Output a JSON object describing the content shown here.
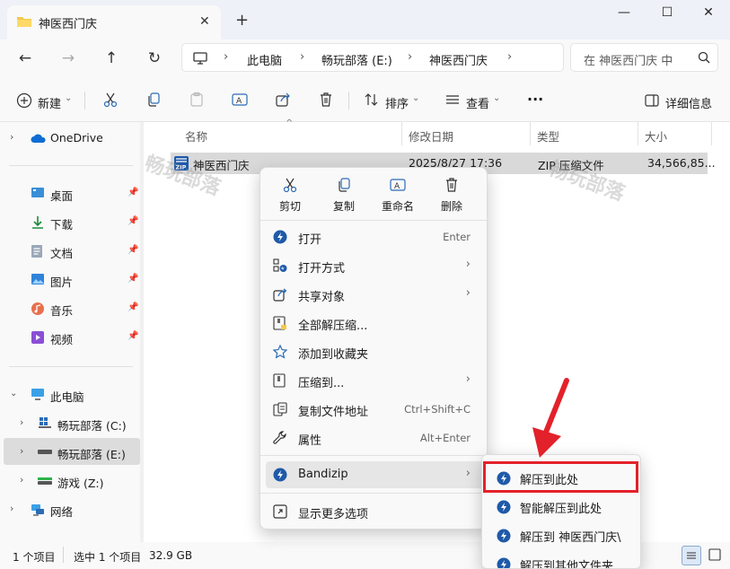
{
  "window": {
    "tab_title": "神医西门庆",
    "tab_close": "✕",
    "new_tab": "+",
    "minimize": "—",
    "maximize": "☐",
    "close": "✕"
  },
  "nav": {
    "back": "←",
    "forward": "→",
    "up": "↑",
    "refresh": "↻",
    "breadcrumb": [
      "此电脑",
      "畅玩部落 (E:)",
      "神医西门庆"
    ],
    "search_placeholder": "在 神医西门庆 中"
  },
  "toolbar": {
    "new_label": "新建",
    "sort_label": "排序",
    "view_label": "查看",
    "more_label": "···",
    "details_label": "详细信息"
  },
  "sidebar": {
    "onedrive": "OneDrive",
    "quick": [
      {
        "label": "桌面",
        "icon": "desktop-icon"
      },
      {
        "label": "下载",
        "icon": "download-icon"
      },
      {
        "label": "文档",
        "icon": "document-icon"
      },
      {
        "label": "图片",
        "icon": "pictures-icon"
      },
      {
        "label": "音乐",
        "icon": "music-icon"
      },
      {
        "label": "视频",
        "icon": "video-icon"
      }
    ],
    "this_pc": "此电脑",
    "drives": [
      {
        "label": "畅玩部落 (C:)"
      },
      {
        "label": "畅玩部落 (E:)"
      },
      {
        "label": "游戏 (Z:)"
      }
    ],
    "network": "网络"
  },
  "columns": {
    "name": "名称",
    "date": "修改日期",
    "type": "类型",
    "size": "大小"
  },
  "file": {
    "name": "神医西门庆",
    "date": "2025/8/27 17:36",
    "type": "ZIP 压缩文件",
    "size": "34,566,85..."
  },
  "watermark": "畅玩部落",
  "statusbar": {
    "count": "1 个项目",
    "selected": "选中 1 个项目",
    "size": "32.9 GB"
  },
  "context_menu": {
    "quick_actions": [
      {
        "label": "剪切",
        "icon": "cut-icon"
      },
      {
        "label": "复制",
        "icon": "copy-icon"
      },
      {
        "label": "重命名",
        "icon": "rename-icon"
      },
      {
        "label": "删除",
        "icon": "delete-icon"
      }
    ],
    "items": [
      {
        "label": "打开",
        "shortcut": "Enter"
      },
      {
        "label": "打开方式"
      },
      {
        "label": "共享对象"
      },
      {
        "label": "全部解压缩..."
      },
      {
        "label": "添加到收藏夹"
      },
      {
        "label": "压缩到..."
      },
      {
        "label": "复制文件地址",
        "shortcut": "Ctrl+Shift+C"
      },
      {
        "label": "属性",
        "shortcut": "Alt+Enter"
      },
      {
        "label": "Bandizip"
      },
      {
        "label": "显示更多选项"
      }
    ],
    "submenu_arrow": "›"
  },
  "submenu": {
    "items": [
      {
        "label": "解压到此处"
      },
      {
        "label": "智能解压到此处"
      },
      {
        "label": "解压到 神医西门庆\\"
      },
      {
        "label": "解压到其他文件夹..."
      }
    ]
  },
  "colors": {
    "accent": "#0067c0",
    "highlight_box": "#e3212a",
    "selection": "#d9d9d9"
  }
}
